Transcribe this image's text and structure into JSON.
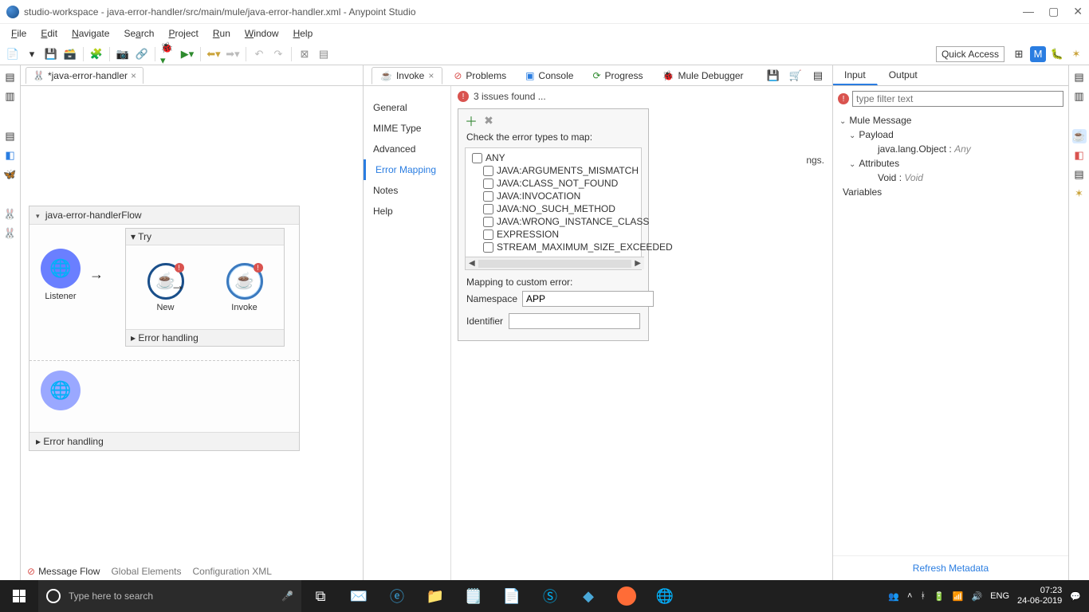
{
  "title": "studio-workspace - java-error-handler/src/main/mule/java-error-handler.xml - Anypoint Studio",
  "menu": [
    "File",
    "Edit",
    "Navigate",
    "Search",
    "Project",
    "Run",
    "Window",
    "Help"
  ],
  "quick_access": "Quick Access",
  "editor_tab": {
    "label": "*java-error-handler",
    "close": "×"
  },
  "flow": {
    "name": "java-error-handlerFlow",
    "listener": "Listener",
    "try": "Try",
    "new": "New",
    "invoke": "Invoke",
    "err_handling": "Error handling"
  },
  "bottom_tabs": {
    "msg_flow": "Message Flow",
    "global": "Global Elements",
    "config": "Configuration XML"
  },
  "view_tabs": {
    "invoke": "Invoke",
    "problems": "Problems",
    "console": "Console",
    "progress": "Progress",
    "debugger": "Mule Debugger"
  },
  "props_side": [
    "General",
    "MIME Type",
    "Advanced",
    "Error Mapping",
    "Notes",
    "Help"
  ],
  "issues": "3 issues found ...",
  "error_map": {
    "check_label": "Check the error types to map:",
    "types": [
      {
        "label": "ANY",
        "indent": false
      },
      {
        "label": "JAVA:ARGUMENTS_MISMATCH",
        "indent": true
      },
      {
        "label": "JAVA:CLASS_NOT_FOUND",
        "indent": true
      },
      {
        "label": "JAVA:INVOCATION",
        "indent": true
      },
      {
        "label": "JAVA:NO_SUCH_METHOD",
        "indent": true
      },
      {
        "label": "JAVA:WRONG_INSTANCE_CLASS",
        "indent": true
      },
      {
        "label": "EXPRESSION",
        "indent": true
      },
      {
        "label": "STREAM_MAXIMUM_SIZE_EXCEEDED",
        "indent": true
      }
    ],
    "custom_label": "Mapping to custom error:",
    "namespace_label": "Namespace",
    "namespace_value": "APP",
    "identifier_label": "Identifier",
    "identifier_value": "",
    "trail_text": "ngs."
  },
  "meta": {
    "tabs": {
      "input": "Input",
      "output": "Output"
    },
    "filter_placeholder": "type filter text",
    "tree": {
      "mule_msg": "Mule Message",
      "payload": "Payload",
      "payload_val_k": "java.lang.Object : ",
      "payload_val_v": "Any",
      "attributes": "Attributes",
      "attr_val_k": "Void : ",
      "attr_val_v": "Void",
      "variables": "Variables"
    },
    "refresh": "Refresh Metadata"
  },
  "taskbar": {
    "search": "Type here to search",
    "lang": "ENG",
    "time": "07:23",
    "date": "24-06-2019"
  }
}
